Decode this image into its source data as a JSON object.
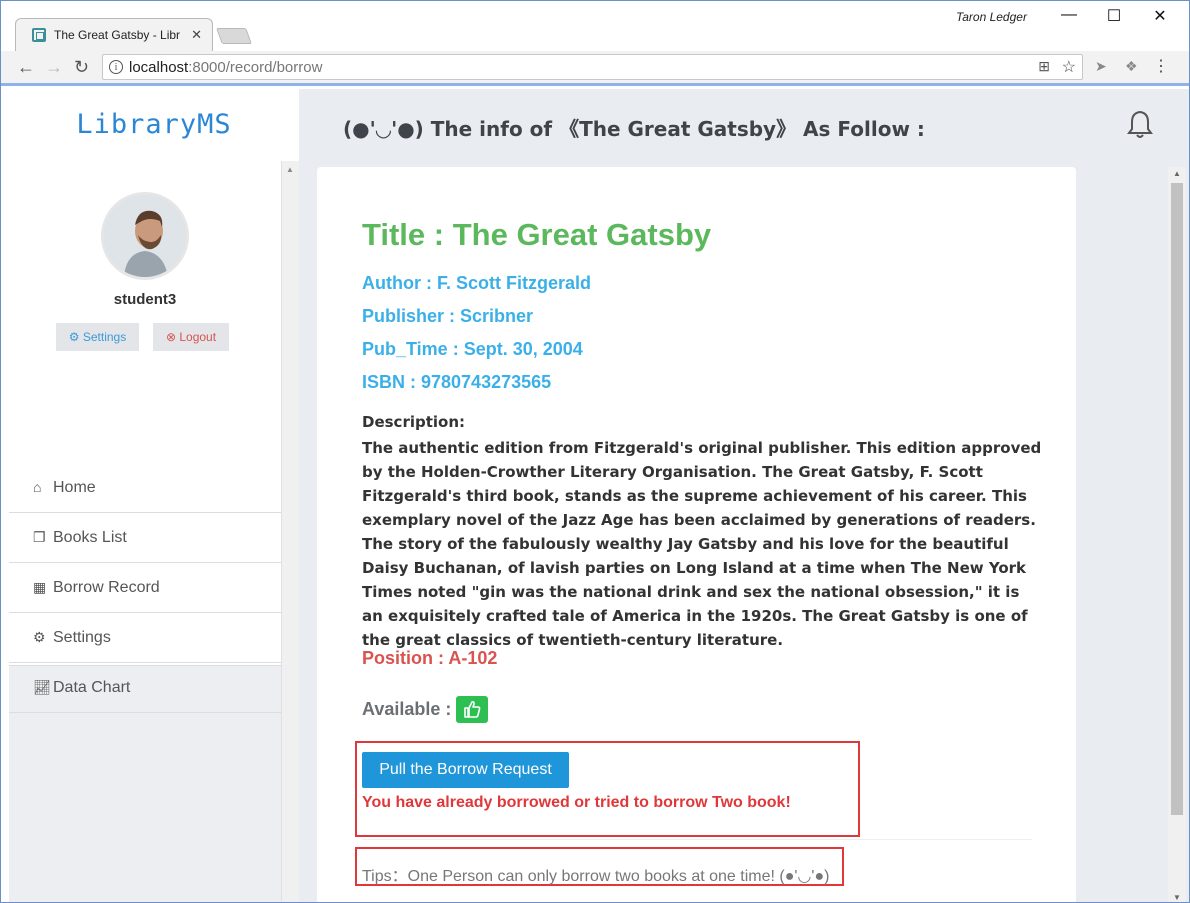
{
  "browser": {
    "tab_title": "The Great Gatsby - Libr",
    "user": "Taron Ledger",
    "url_host": "localhost",
    "url_path": ":8000/record/borrow",
    "controls": {
      "minimize": "—",
      "maximize": "☐",
      "close": "✕"
    }
  },
  "app": {
    "brand": "LibraryMS",
    "heading": "(●'◡'●) The info of 《The Great Gatsby》 As Follow :"
  },
  "sidebar": {
    "username": "student3",
    "settings_btn": "Settings",
    "logout_btn": "Logout",
    "items": [
      {
        "label": "Home",
        "icon": "home-icon"
      },
      {
        "label": "Books List",
        "icon": "books-icon"
      },
      {
        "label": "Borrow Record",
        "icon": "table-icon"
      },
      {
        "label": "Settings",
        "icon": "gear-icon"
      },
      {
        "label": "Data Chart",
        "icon": "line-chart-icon"
      }
    ]
  },
  "book": {
    "title": "Title : The Great Gatsby",
    "author": "Author : F. Scott Fitzgerald",
    "publisher": "Publisher : Scribner",
    "pub_time": "Pub_Time : Sept. 30, 2004",
    "isbn": "ISBN : 9780743273565",
    "description_label": "Description:",
    "description": "The authentic edition from Fitzgerald's original publisher. This edition approved by the Holden-Crowther Literary Organisation. The Great Gatsby, F. Scott Fitzgerald's third book, stands as the supreme achievement of his career. This exemplary novel of the Jazz Age has been acclaimed by generations of readers. The story of the fabulously wealthy Jay Gatsby and his love for the beautiful Daisy Buchanan, of lavish parties on Long Island at a time when The New York Times noted \"gin was the national drink and sex the national obsession,\" it is an exquisitely crafted tale of America in the 1920s. The Great Gatsby is one of the great classics of twentieth-century literature.",
    "position": "Position : A-102",
    "available_label": "Available :",
    "borrow_button": "Pull the Borrow Request",
    "warning": "You have already borrowed or tried to borrow Two book!",
    "tips": "Tips：One Person can only borrow two books at one time! (●'◡'●)"
  },
  "colors": {
    "brand": "#2b86d6",
    "title": "#5cb85c",
    "meta": "#3bb0e8",
    "danger": "#d9534f",
    "primary_button": "#1e96d9",
    "available_badge": "#2dbf52"
  }
}
